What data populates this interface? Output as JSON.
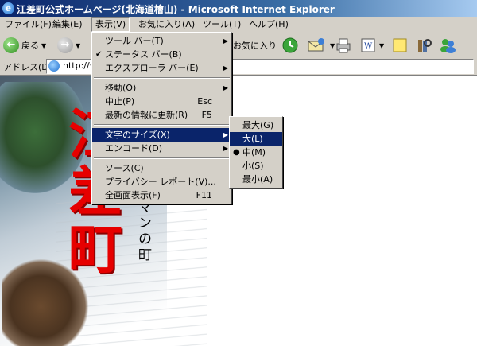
{
  "window": {
    "title": "江差町公式ホームページ(北海道檜山) - Microsoft Internet Explorer"
  },
  "menubar": [
    {
      "label": "ファイル(F)"
    },
    {
      "label": "編集(E)"
    },
    {
      "label": "表示(V)"
    },
    {
      "label": "お気に入り(A)"
    },
    {
      "label": "ツール(T)"
    },
    {
      "label": "ヘルプ(H)"
    }
  ],
  "toolbar": {
    "back_label": "戻る",
    "favorites_label": "お気に入り"
  },
  "address": {
    "label": "アドレス(D)",
    "value": "http://w"
  },
  "page": {
    "kanji": [
      "江",
      "差",
      "町"
    ],
    "vertical_text": "ロマンの町"
  },
  "view_menu": {
    "items": [
      {
        "label": "ツール バー(T)",
        "has_submenu": true
      },
      {
        "label": "ステータス バー(B)",
        "checked": true
      },
      {
        "label": "エクスプローラ バー(E)",
        "has_submenu": true
      },
      {
        "separator": true
      },
      {
        "label": "移動(O)",
        "has_submenu": true
      },
      {
        "label": "中止(P)",
        "shortcut": "Esc"
      },
      {
        "label": "最新の情報に更新(R)",
        "shortcut": "F5"
      },
      {
        "separator": true
      },
      {
        "label": "文字のサイズ(X)",
        "has_submenu": true,
        "selected": true
      },
      {
        "label": "エンコード(D)",
        "has_submenu": true
      },
      {
        "separator": true
      },
      {
        "label": "ソース(C)"
      },
      {
        "label": "プライバシー レポート(V)..."
      },
      {
        "label": "全画面表示(F)",
        "shortcut": "F11"
      }
    ]
  },
  "text_size_menu": {
    "items": [
      {
        "label": "最大(G)"
      },
      {
        "label": "大(L)",
        "selected": true
      },
      {
        "label": "中(M)",
        "radio": true
      },
      {
        "label": "小(S)"
      },
      {
        "label": "最小(A)"
      }
    ]
  },
  "colors": {
    "title_bar": "#0a246a",
    "selection": "#0a246a",
    "kanji": "#e60000"
  }
}
